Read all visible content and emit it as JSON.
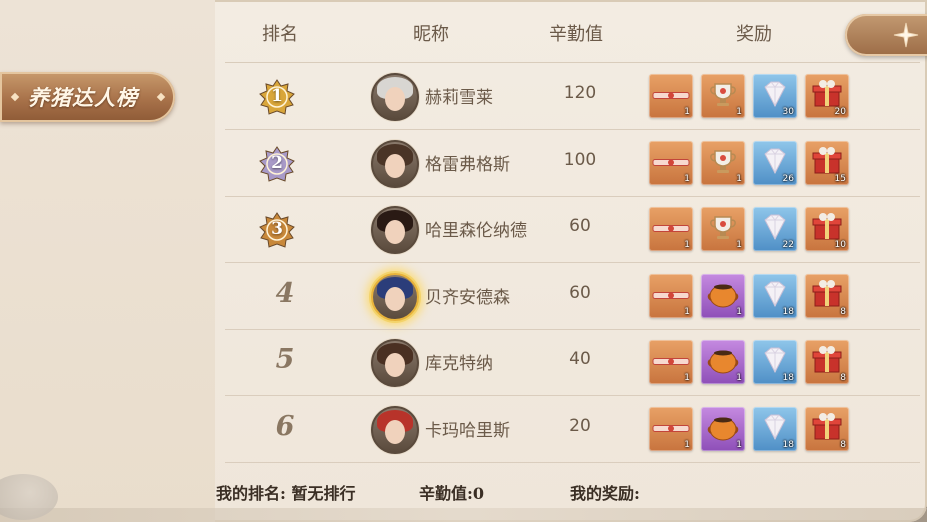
{
  "board": {
    "title": "养猪达人榜",
    "headers": {
      "rank": "排名",
      "nickname": "昵称",
      "score": "辛勤值",
      "reward": "奖励"
    }
  },
  "rows": [
    {
      "rank": "1",
      "name": "赫莉雪莱",
      "score": "120",
      "medal_color": "#d9a63a",
      "avatar": {
        "hair": "#d8d6d2"
      },
      "rewards": [
        {
          "item": "ribbon-ticket-icon",
          "count": "1",
          "bg": "orange"
        },
        {
          "item": "trophy-cup-icon",
          "count": "1",
          "bg": "orange"
        },
        {
          "item": "diamond-icon",
          "count": "30",
          "bg": "blue"
        },
        {
          "item": "gift-box-icon",
          "count": "20",
          "bg": "orange"
        }
      ]
    },
    {
      "rank": "2",
      "name": "格雷弗格斯",
      "score": "100",
      "medal_color": "#a89ac8",
      "avatar": {
        "hair": "#4a3426"
      },
      "rewards": [
        {
          "item": "ribbon-ticket-icon",
          "count": "1",
          "bg": "orange"
        },
        {
          "item": "trophy-cup-icon",
          "count": "1",
          "bg": "orange"
        },
        {
          "item": "diamond-icon",
          "count": "26",
          "bg": "blue"
        },
        {
          "item": "gift-box-icon",
          "count": "15",
          "bg": "orange"
        }
      ]
    },
    {
      "rank": "3",
      "name": "哈里森伦纳德",
      "score": "60",
      "medal_color": "#c8883a",
      "avatar": {
        "hair": "#2a1a14"
      },
      "rewards": [
        {
          "item": "ribbon-ticket-icon",
          "count": "1",
          "bg": "orange"
        },
        {
          "item": "trophy-cup-icon",
          "count": "1",
          "bg": "orange"
        },
        {
          "item": "diamond-icon",
          "count": "22",
          "bg": "blue"
        },
        {
          "item": "gift-box-icon",
          "count": "10",
          "bg": "orange"
        }
      ]
    },
    {
      "rank": "4",
      "name": "贝齐安德森",
      "score": "60",
      "avatar": {
        "hair": "#2b3d7a",
        "glow": true
      },
      "rewards": [
        {
          "item": "ribbon-ticket-icon",
          "count": "1",
          "bg": "orange"
        },
        {
          "item": "pumpkin-pot-icon",
          "count": "1",
          "bg": "purple"
        },
        {
          "item": "diamond-icon",
          "count": "18",
          "bg": "blue"
        },
        {
          "item": "gift-box-icon",
          "count": "8",
          "bg": "orange"
        }
      ]
    },
    {
      "rank": "5",
      "name": "库克特纳",
      "score": "40",
      "avatar": {
        "hair": "#4a3022"
      },
      "rewards": [
        {
          "item": "ribbon-ticket-icon",
          "count": "1",
          "bg": "orange"
        },
        {
          "item": "pumpkin-pot-icon",
          "count": "1",
          "bg": "purple"
        },
        {
          "item": "diamond-icon",
          "count": "18",
          "bg": "blue"
        },
        {
          "item": "gift-box-icon",
          "count": "8",
          "bg": "orange"
        }
      ]
    },
    {
      "rank": "6",
      "name": "卡玛哈里斯",
      "score": "20",
      "avatar": {
        "hair": "#b8332a"
      },
      "rewards": [
        {
          "item": "ribbon-ticket-icon",
          "count": "1",
          "bg": "orange"
        },
        {
          "item": "pumpkin-pot-icon",
          "count": "1",
          "bg": "purple"
        },
        {
          "item": "diamond-icon",
          "count": "18",
          "bg": "blue"
        },
        {
          "item": "gift-box-icon",
          "count": "8",
          "bg": "orange"
        }
      ]
    }
  ],
  "footer": {
    "my_rank": "我的排名: 暂无排行",
    "my_score": "辛勤值:0",
    "my_reward": "我的奖励:"
  }
}
